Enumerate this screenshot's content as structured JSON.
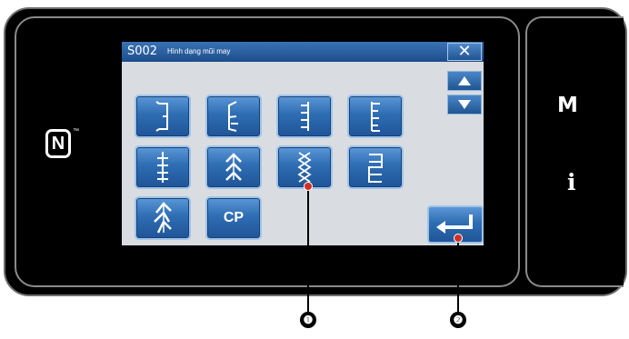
{
  "window": {
    "code": "S002",
    "title": "Hình dạng mũi may"
  },
  "controls": {
    "close": "✕",
    "scroll_up": "up-arrow",
    "scroll_down": "down-arrow",
    "enter": "enter-arrow"
  },
  "pattern_buttons": [
    {
      "icon": "stitch-shape-1"
    },
    {
      "icon": "stitch-shape-2"
    },
    {
      "icon": "stitch-shape-3"
    },
    {
      "icon": "stitch-shape-4"
    },
    {
      "icon": "stitch-shape-5"
    },
    {
      "icon": "stitch-shape-6"
    },
    {
      "icon": "stitch-shape-7"
    },
    {
      "icon": "stitch-shape-8"
    },
    {
      "icon": "stitch-shape-9"
    },
    {
      "label": "CP"
    }
  ],
  "side_panel": {
    "nfc_mark": "N",
    "nfc_tm": "™",
    "m_key": "M",
    "i_key": "i"
  },
  "callouts": {
    "one": "❶",
    "two": "❷"
  },
  "colors": {
    "button_blue": "#2f6db3",
    "titlebar_blue": "#1c4d8c",
    "callout_red": "#d0302a"
  }
}
